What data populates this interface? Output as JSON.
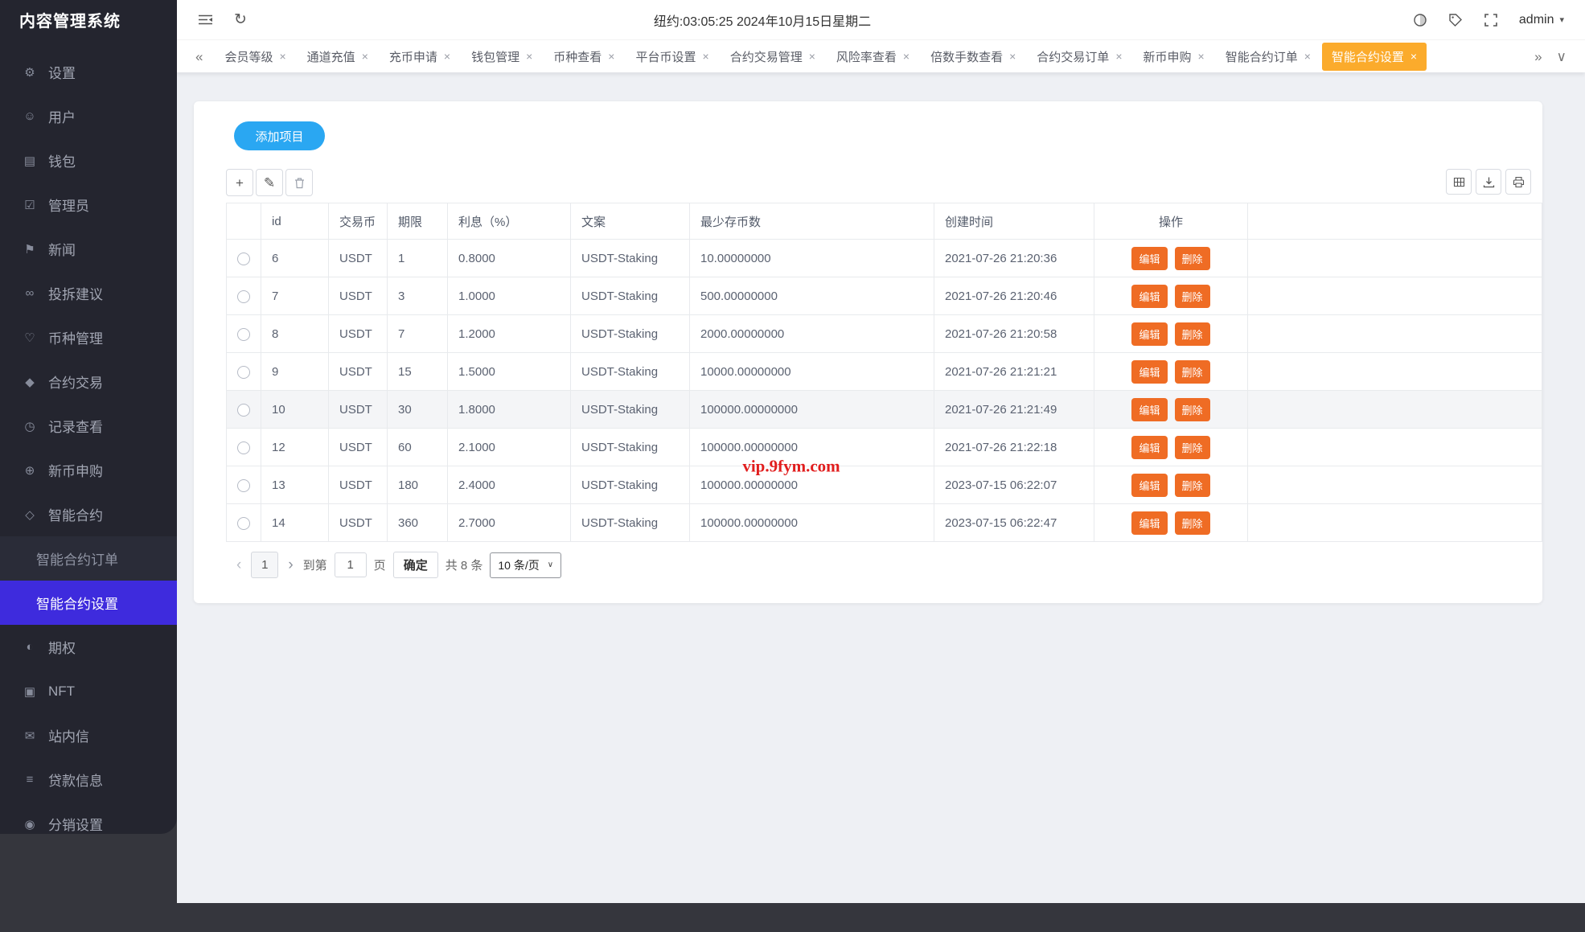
{
  "app": {
    "title": "内容管理系统"
  },
  "header": {
    "clock": "纽约:03:05:25 2024年10月15日星期二",
    "username": "admin"
  },
  "tabs": [
    {
      "label": "会员等级"
    },
    {
      "label": "通道充值"
    },
    {
      "label": "充币申请"
    },
    {
      "label": "钱包管理"
    },
    {
      "label": "币种查看"
    },
    {
      "label": "平台币设置"
    },
    {
      "label": "合约交易管理"
    },
    {
      "label": "风险率查看"
    },
    {
      "label": "倍数手数查看"
    },
    {
      "label": "合约交易订单"
    },
    {
      "label": "新币申购"
    },
    {
      "label": "智能合约订单"
    },
    {
      "label": "智能合约设置",
      "active": true
    }
  ],
  "sidebar": {
    "items": [
      {
        "label": "设置",
        "icon": "gear"
      },
      {
        "label": "用户",
        "icon": "user"
      },
      {
        "label": "钱包",
        "icon": "wallet"
      },
      {
        "label": "管理员",
        "icon": "admin-badge"
      },
      {
        "label": "新闻",
        "icon": "news-flag"
      },
      {
        "label": "投拆建议",
        "icon": "feedback-link"
      },
      {
        "label": "币种管理",
        "icon": "coin-heart"
      },
      {
        "label": "合约交易",
        "icon": "contract-diamond"
      },
      {
        "label": "记录查看",
        "icon": "records-clock"
      },
      {
        "label": "新币申购",
        "icon": "new-coin-plus"
      },
      {
        "label": "智能合约",
        "icon": "smart-contract"
      },
      {
        "label": "智能合约订单",
        "sub": true
      },
      {
        "label": "智能合约设置",
        "sub": true,
        "active": true
      },
      {
        "label": "期权",
        "icon": "options-half"
      },
      {
        "label": "NFT",
        "icon": "nft-box"
      },
      {
        "label": "站内信",
        "icon": "mail"
      },
      {
        "label": "贷款信息",
        "icon": "loan-doc"
      },
      {
        "label": "分销设置",
        "icon": "distribution"
      }
    ]
  },
  "toolbar": {
    "add_label": "添加项目"
  },
  "table": {
    "columns": [
      "id",
      "交易币",
      "期限",
      "利息（%）",
      "文案",
      "最少存币数",
      "创建时间",
      "操作"
    ],
    "action_labels": {
      "edit": "编辑",
      "delete": "删除"
    },
    "rows": [
      {
        "id": "6",
        "coin": "USDT",
        "term": "1",
        "interest": "0.8000",
        "text": "USDT-Staking",
        "min": "10.00000000",
        "created": "2021-07-26 21:20:36"
      },
      {
        "id": "7",
        "coin": "USDT",
        "term": "3",
        "interest": "1.0000",
        "text": "USDT-Staking",
        "min": "500.00000000",
        "created": "2021-07-26 21:20:46"
      },
      {
        "id": "8",
        "coin": "USDT",
        "term": "7",
        "interest": "1.2000",
        "text": "USDT-Staking",
        "min": "2000.00000000",
        "created": "2021-07-26 21:20:58"
      },
      {
        "id": "9",
        "coin": "USDT",
        "term": "15",
        "interest": "1.5000",
        "text": "USDT-Staking",
        "min": "10000.00000000",
        "created": "2021-07-26 21:21:21"
      },
      {
        "id": "10",
        "coin": "USDT",
        "term": "30",
        "interest": "1.8000",
        "text": "USDT-Staking",
        "min": "100000.00000000",
        "created": "2021-07-26 21:21:49",
        "highlighted": true
      },
      {
        "id": "12",
        "coin": "USDT",
        "term": "60",
        "interest": "2.1000",
        "text": "USDT-Staking",
        "min": "100000.00000000",
        "created": "2021-07-26 21:22:18"
      },
      {
        "id": "13",
        "coin": "USDT",
        "term": "180",
        "interest": "2.4000",
        "text": "USDT-Staking",
        "min": "100000.00000000",
        "created": "2023-07-15 06:22:07"
      },
      {
        "id": "14",
        "coin": "USDT",
        "term": "360",
        "interest": "2.7000",
        "text": "USDT-Staking",
        "min": "100000.00000000",
        "created": "2023-07-15 06:22:47"
      }
    ]
  },
  "pagination": {
    "current_page": "1",
    "goto_label": "到第",
    "goto_value": "1",
    "page_label": "页",
    "confirm_label": "确定",
    "total_label": "共 8 条",
    "page_size": "10 条/页"
  },
  "watermark": "vip.9fym.com",
  "icons": {
    "gear": "⚙",
    "user": "☺",
    "wallet": "▤",
    "admin-badge": "☑",
    "news-flag": "⚑",
    "feedback-link": "∞",
    "coin-heart": "♡",
    "contract-diamond": "◆",
    "records-clock": "◷",
    "new-coin-plus": "⊕",
    "smart-contract": "◇",
    "options-half": "◐",
    "nft-box": "▣",
    "mail": "✉",
    "loan-doc": "≡",
    "distribution": "◉",
    "refresh": "↻",
    "chevron-down": "▾",
    "tabs-scroll-left": "«",
    "tabs-scroll-right": "»",
    "tabs-menu": "∨",
    "close": "×",
    "plus": "+",
    "pencil": "✎",
    "prev": "‹",
    "next": "›",
    "select-caret": "∨"
  },
  "colors": {
    "accent": "#2aa7f2",
    "active_tab": "#fbab2c",
    "action_orange": "#ef6c24",
    "active_menu": "#3e2bdd",
    "sidebar_bg": "#24252f",
    "page_bg": "#35363d",
    "watermark_red": "#e11d1d"
  }
}
